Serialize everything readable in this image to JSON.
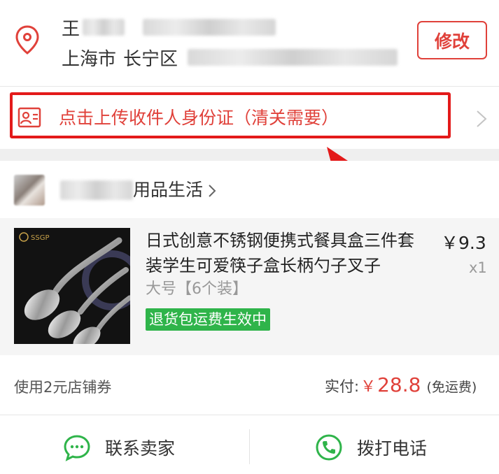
{
  "address": {
    "name_visible": "王",
    "city": "上海市",
    "district": "长宁区",
    "modify_label": "修改"
  },
  "id_upload": {
    "label": "点击上传收件人身份证（清关需要）",
    "icon": "id-card-icon"
  },
  "store": {
    "name_visible": "用品生活",
    "chevron_icon": "chevron-right-icon"
  },
  "product": {
    "title": "日式创意不锈钢便携式餐具盒三件套装学生可爱筷子盒长柄勺子叉子",
    "spec": "大号【6个装】",
    "badge": "退货包运费生效中",
    "price": "￥9.3",
    "qty": "x1",
    "image_brand": "SSGP"
  },
  "summary": {
    "coupon": "使用2元店铺券",
    "pay_label": "实付:",
    "pay_yen": "￥",
    "pay_amount": "28.8",
    "pay_note": "(免运费)"
  },
  "actions": {
    "contact_seller": "联系卖家",
    "call_phone": "拨打电话"
  },
  "colors": {
    "accent": "#e0413a",
    "highlight_box": "#e31a1a",
    "green": "#2fb44a",
    "background_gap": "#efefef"
  }
}
